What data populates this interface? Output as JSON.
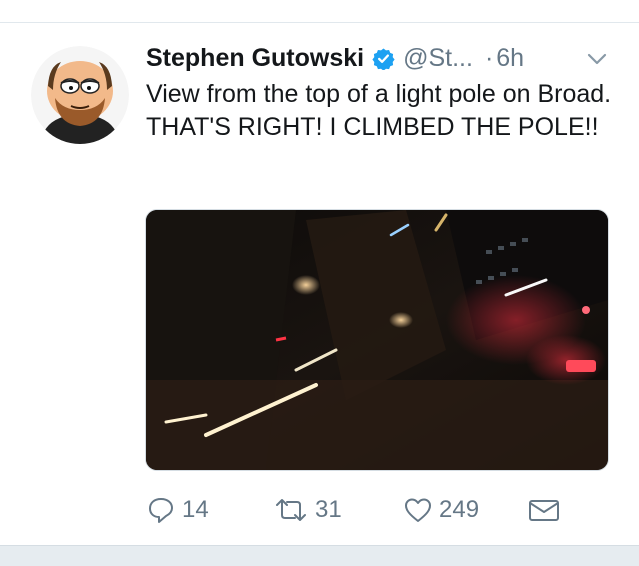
{
  "tweet": {
    "display_name": "Stephen Gutowski",
    "handle": "@St...",
    "dot": "·",
    "time": "6h",
    "text": "View from the top of a light pole on Broad. THAT'S RIGHT! I CLIMBED THE POLE!!",
    "avatar_icon": "cartoon-avatar-icon",
    "verified_icon": "verified-badge-icon",
    "media_description_icon": "night-street-photo"
  },
  "actions": {
    "reply_count": "14",
    "retweet_count": "31",
    "like_count": "249"
  },
  "colors": {
    "verified_blue": "#1da1f2",
    "secondary_text": "#657786",
    "primary_text": "#14171a"
  }
}
